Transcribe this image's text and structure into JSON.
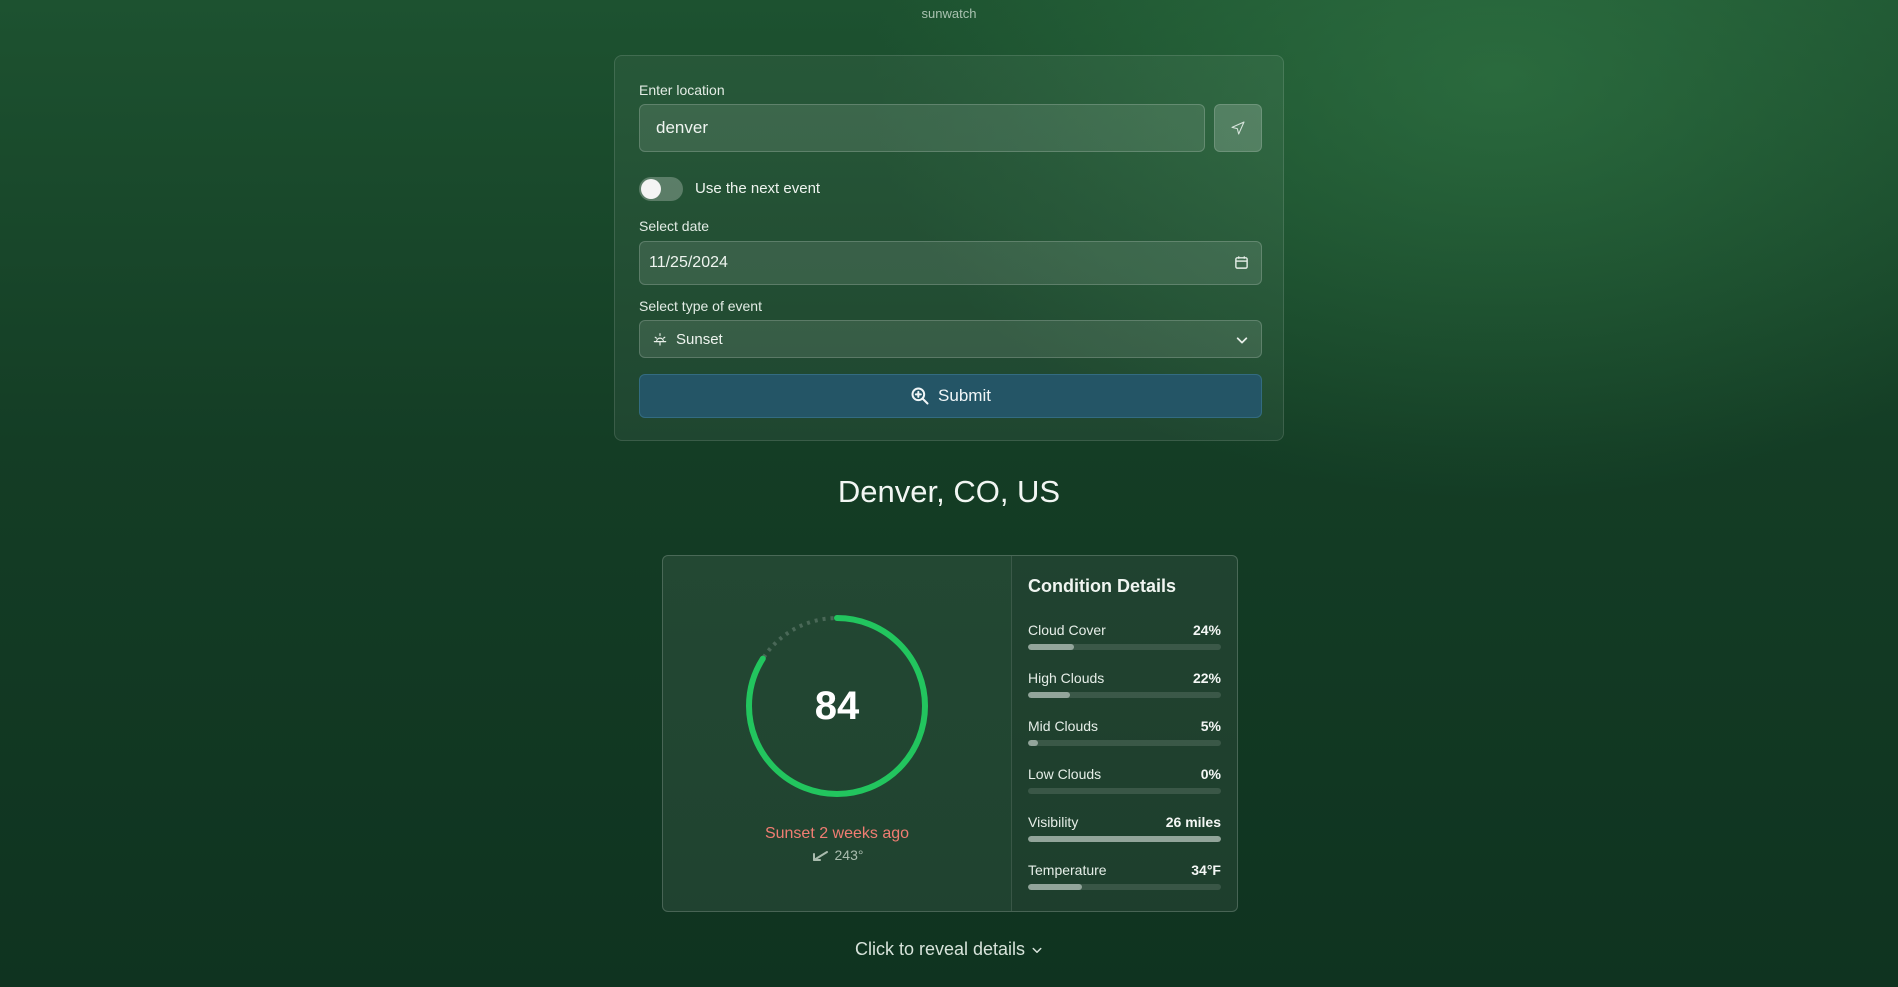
{
  "app": {
    "title": "sunwatch"
  },
  "form": {
    "location_label": "Enter location",
    "location_value": "denver",
    "toggle_label": "Use the next event",
    "toggle_on": false,
    "date_label": "Select date",
    "date_value": "11/25/2024",
    "event_label": "Select type of event",
    "event_value": "Sunset",
    "submit_label": "Submit"
  },
  "result": {
    "location": "Denver, CO, US",
    "score": "84",
    "score_fraction": 0.84,
    "gauge_color": "#22c55e",
    "event_text": "Sunset 2 weeks ago",
    "azimuth": "243°",
    "event_color": "#f07d72"
  },
  "conditions": {
    "title": "Condition Details",
    "items": [
      {
        "name": "Cloud Cover",
        "value": "24%",
        "fraction": 0.24
      },
      {
        "name": "High Clouds",
        "value": "22%",
        "fraction": 0.22
      },
      {
        "name": "Mid Clouds",
        "value": "5%",
        "fraction": 0.05
      },
      {
        "name": "Low Clouds",
        "value": "0%",
        "fraction": 0.0
      },
      {
        "name": "Visibility",
        "value": "26 miles",
        "fraction": 1.0
      },
      {
        "name": "Temperature",
        "value": "34°F",
        "fraction": 0.28
      }
    ]
  },
  "reveal": {
    "label": "Click to reveal details"
  }
}
